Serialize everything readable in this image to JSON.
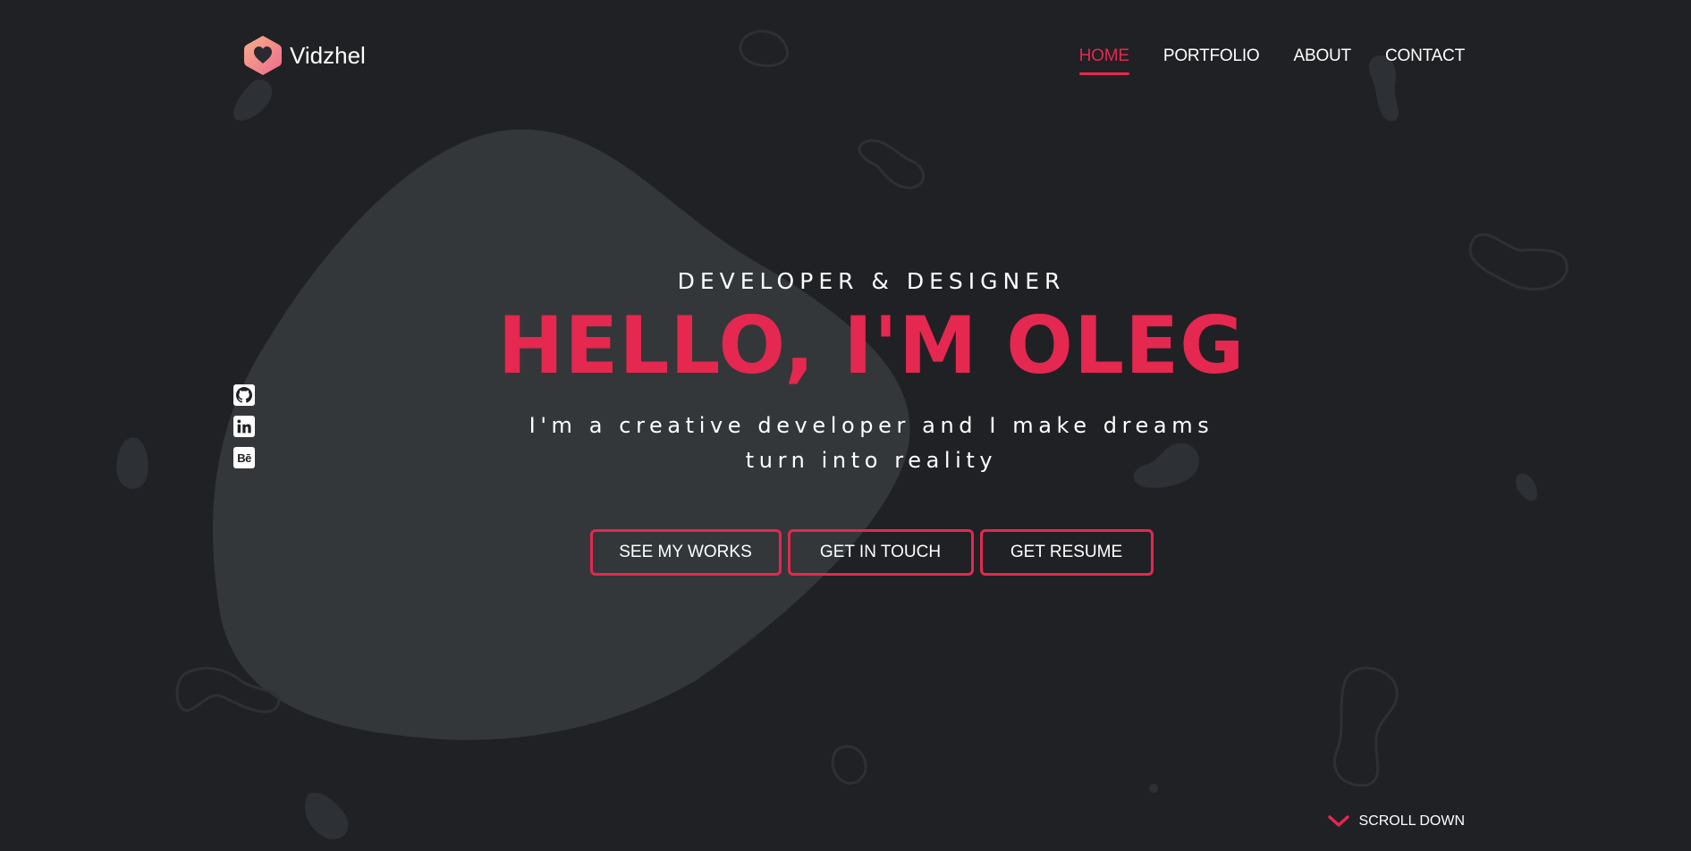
{
  "brand": {
    "name": "Vidzhel",
    "logo_icon": "heart-hexagon-icon",
    "accent": "#e4284f",
    "background": "#202125",
    "blob": "#33373a"
  },
  "nav": {
    "items": [
      {
        "label": "HOME",
        "active": true
      },
      {
        "label": "PORTFOLIO",
        "active": false
      },
      {
        "label": "ABOUT",
        "active": false
      },
      {
        "label": "CONTACT",
        "active": false
      }
    ]
  },
  "social": {
    "items": [
      {
        "icon": "github-icon",
        "label": ""
      },
      {
        "icon": "linkedin-icon",
        "label": ""
      },
      {
        "icon": "behance-icon",
        "label": "Bē"
      }
    ]
  },
  "hero": {
    "tagline": "DEVELOPER & DESIGNER",
    "headline": "HELLO, I'M OLEG",
    "subtitle": "I'm a creative developer and I make dreams turn into reality"
  },
  "buttons": {
    "works": "SEE MY WORKS",
    "touch": "GET IN TOUCH",
    "resume": "GET RESUME"
  },
  "scroll": {
    "label": "SCROLL DOWN",
    "icon": "chevron-down-icon"
  }
}
